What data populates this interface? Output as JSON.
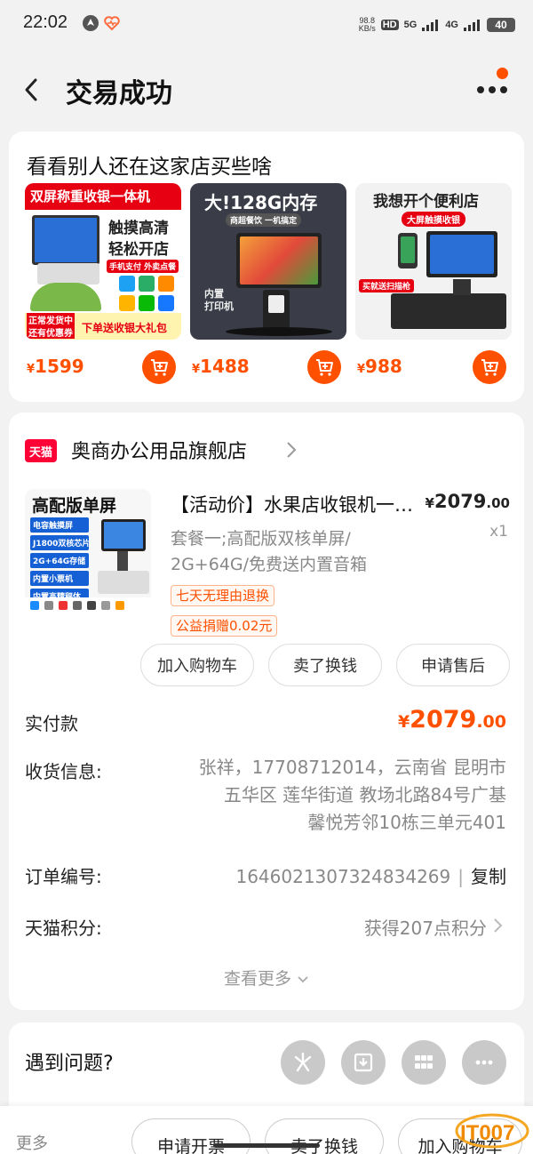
{
  "status_bar": {
    "time": "22:02",
    "net_speed_value": "98.8",
    "net_speed_unit": "KB/s",
    "hd_label": "HD",
    "sim1": "5G",
    "sim2": "4G",
    "battery": "40"
  },
  "nav": {
    "title": "交易成功"
  },
  "recommend": {
    "title": "看看别人还在这家店买些啥",
    "items": [
      {
        "price_symbol": "¥",
        "price": "1599",
        "img_line1": "双屏称重收银一体机",
        "img_line2": "触摸高清",
        "img_line3": "轻松开店",
        "img_badge1": "手机支付 外卖点餐",
        "img_footer1": "正常发货中",
        "img_footer2": "还有优惠券",
        "img_footer3": "下单送收银大礼包"
      },
      {
        "price_symbol": "¥",
        "price": "1488",
        "img_line1": "大!128G内存",
        "img_badge1": "商超餐饮 一机搞定",
        "img_footer1": "内置",
        "img_footer2": "打印机"
      },
      {
        "price_symbol": "¥",
        "price": "988",
        "img_line1": "我想开个便利店",
        "img_badge1": "大屏触摸收银",
        "img_footer1": "买就送扫描枪"
      }
    ]
  },
  "order": {
    "shop_badge": "天猫",
    "shop_name": "奥商办公用品旗舰店",
    "product": {
      "img_title": "高配版单屏",
      "img_tags": [
        "电容触摸屏",
        "J1800双核芯片",
        "2G+64G存储",
        "内置小票机",
        "内置高精秤体"
      ],
      "title": "【活动价】水果店收银机一体机",
      "price_symbol": "¥",
      "price_int": "2079",
      "price_dec": ".00",
      "qty": "x1",
      "sku_line1": "套餐一;高配版双核单屏/",
      "sku_line2": "2G+64G/免费送内置音箱",
      "tag1": "七天无理由退换",
      "tag2": "公益捐赠0.02元"
    },
    "buttons": {
      "add_cart": "加入购物车",
      "resell": "卖了换钱",
      "after_sale": "申请售后"
    },
    "paid_label": "实付款",
    "paid_symbol": "¥",
    "paid_int": "2079",
    "paid_dec": ".00",
    "shipping_label": "收货信息:",
    "address_line1": "张祥，17708712014，云南省 昆明市",
    "address_line2": "五华区    莲华街道 教场北路84号广基",
    "address_line3": "馨悦芳邻10栋三单元401",
    "order_no_label": "订单编号:",
    "order_no": "1646021307324834269",
    "order_sep": "|",
    "copy_label": "复制",
    "points_label": "天猫积分:",
    "points_value": "获得207点积分",
    "see_more": "查看更多"
  },
  "help": {
    "title": "遇到问题?"
  },
  "bottom_bar": {
    "more": "更多",
    "invoice": "申请开票",
    "resell": "卖了换钱",
    "add_cart": "加入购物车"
  },
  "watermark": {
    "text": "IT007"
  },
  "colors": {
    "accent": "#ff5000",
    "tmall_red": "#ff0036",
    "page_bg": "#f2f2f2"
  }
}
